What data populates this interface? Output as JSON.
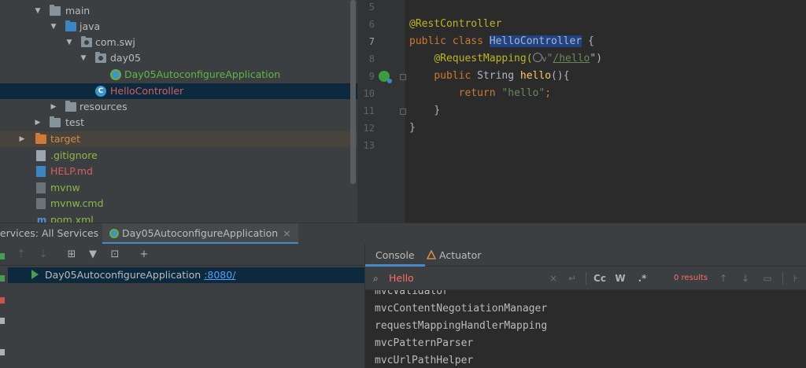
{
  "tree": {
    "items": [
      {
        "label": "main",
        "color": "#bbbbbb",
        "chevron": "open",
        "icon": "folder-icon"
      },
      {
        "label": "java",
        "color": "#bbbbbb",
        "chevron": "open",
        "icon": "source-folder-icon"
      },
      {
        "label": "com.swj",
        "color": "#bbbbbb",
        "chevron": "open",
        "icon": "package-icon"
      },
      {
        "label": "day05",
        "color": "#bbbbbb",
        "chevron": "open",
        "icon": "package-icon"
      },
      {
        "label": "Day05AutoconfigureApplication",
        "color": "#62b543",
        "icon": "spring-boot-class-icon"
      },
      {
        "label": "HelloController",
        "color": "#d65f5f",
        "icon": "java-class-icon",
        "selected": true
      },
      {
        "label": "resources",
        "color": "#bbbbbb",
        "chevron": "closed",
        "icon": "resources-folder-icon"
      },
      {
        "label": "test",
        "color": "#bbbbbb",
        "chevron": "closed",
        "icon": "folder-icon"
      },
      {
        "label": "target",
        "color": "#d08c48",
        "chevron": "closed",
        "icon": "excluded-folder-icon"
      },
      {
        "label": ".gitignore",
        "color": "#8db845",
        "icon": "gitignore-file-icon"
      },
      {
        "label": "HELP.md",
        "color": "#d65f5f",
        "icon": "markdown-file-icon"
      },
      {
        "label": "mvnw",
        "color": "#8db845",
        "icon": "shell-file-icon"
      },
      {
        "label": "mvnw.cmd",
        "color": "#8db845",
        "icon": "cmd-file-icon"
      },
      {
        "label": "pom.xml",
        "color": "#8db845",
        "icon": "maven-file-icon"
      }
    ]
  },
  "editor": {
    "line_numbers": [
      "5",
      "6",
      "7",
      "8",
      "9",
      "10",
      "11",
      "12",
      "13"
    ],
    "current_line": "7",
    "lines": {
      "l6_annotation": "@RestController",
      "l7_kw": "public class ",
      "l7_class": "HelloController",
      "l7_rest": " {",
      "l8_annotation": "@RequestMapping(",
      "l8_chevron": "v",
      "l8_quote_open": "\"",
      "l8_path": "/hello",
      "l8_quote_close": "\")",
      "l9_kw": "public ",
      "l9_type": "String ",
      "l9_fn": "hello",
      "l9_rest": "(){",
      "l10_kw": "return ",
      "l10_str": "\"hello\"",
      "l10_rest": ";",
      "l11": "}",
      "l12": "}"
    }
  },
  "services_bar": {
    "label": "Services:",
    "tabs": [
      "All Services",
      "Day05AutoconfigureApplication"
    ],
    "close_glyph": "×"
  },
  "services_panel": {
    "toolbar_glyphs": [
      "⇡",
      "⇣",
      "⊞",
      "▼",
      "⊡",
      "+"
    ],
    "app_name": "Day05AutoconfigureApplication",
    "port_link": ":8080/"
  },
  "console": {
    "tabs": [
      "Console",
      "Actuator"
    ],
    "search_value": "Hello",
    "search_buttons": {
      "clear": "×",
      "newline": "↵",
      "match_case": "Cc",
      "words": "W",
      "regex": ".*"
    },
    "results_text": "0 results",
    "output_lines": [
      "mvcValidator",
      "mvcContentNegotiationManager",
      "requestMappingHandlerMapping",
      "mvcPatternParser",
      "mvcUrlPathHelper"
    ]
  },
  "colors": {
    "accent": "#4a88c7",
    "selection": "#0d293e",
    "annotation": "#bbb529",
    "keyword": "#cc7832",
    "string": "#6a8759",
    "function": "#ffc66d"
  }
}
